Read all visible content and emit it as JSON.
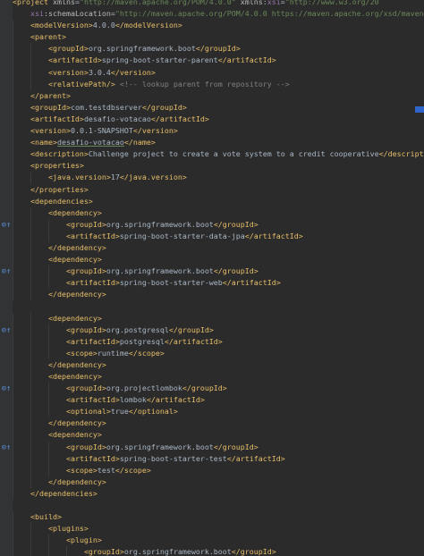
{
  "gutter": {
    "marks": [
      {
        "line": 19,
        "glyph": "⊙↑"
      },
      {
        "line": 23,
        "glyph": "⊙↑"
      },
      {
        "line": 28,
        "glyph": "⊙↑"
      },
      {
        "line": 33,
        "glyph": "⊙↑"
      },
      {
        "line": 38,
        "glyph": "⊙↑"
      }
    ]
  },
  "lines": [
    [
      [
        "t",
        "<project "
      ],
      [
        "a",
        "xmlns"
      ],
      [
        "txt",
        "="
      ],
      [
        "v",
        "\"http://maven.apache.org/POM/4.0.0\" "
      ],
      [
        "a",
        "xmlns"
      ],
      [
        "txt",
        ":"
      ],
      [
        "ns",
        "xsi"
      ],
      [
        "txt",
        "="
      ],
      [
        "v",
        "\"http://www.w3.org/20"
      ]
    ],
    [
      [
        "ns",
        "    xsi"
      ],
      [
        "txt",
        ":"
      ],
      [
        "a",
        "schemaLocation"
      ],
      [
        "txt",
        "="
      ],
      [
        "v",
        "\"http://maven.apache.org/POM/4.0.0 https://maven.apache.org/xsd/maven"
      ]
    ],
    [
      [
        "txt",
        "    "
      ],
      [
        "t",
        "<modelVersion>"
      ],
      [
        "txt",
        "4.0.0"
      ],
      [
        "t",
        "</modelVersion>"
      ]
    ],
    [
      [
        "txt",
        "    "
      ],
      [
        "t",
        "<parent>"
      ]
    ],
    [
      [
        "txt",
        "        "
      ],
      [
        "t",
        "<groupId>"
      ],
      [
        "txt",
        "org.springframework.boot"
      ],
      [
        "t",
        "</groupId>"
      ]
    ],
    [
      [
        "txt",
        "        "
      ],
      [
        "t",
        "<artifactId>"
      ],
      [
        "txt",
        "spring-boot-starter-parent"
      ],
      [
        "t",
        "</artifactId>"
      ]
    ],
    [
      [
        "txt",
        "        "
      ],
      [
        "t",
        "<version>"
      ],
      [
        "txt",
        "3.0.4"
      ],
      [
        "t",
        "</version>"
      ]
    ],
    [
      [
        "txt",
        "        "
      ],
      [
        "t",
        "<relativePath/>"
      ],
      [
        "c",
        " <!-- lookup parent from repository -->"
      ]
    ],
    [
      [
        "txt",
        "    "
      ],
      [
        "t",
        "</parent>"
      ]
    ],
    [
      [
        "txt",
        "    "
      ],
      [
        "t",
        "<groupId>"
      ],
      [
        "txt",
        "com.testdbserver"
      ],
      [
        "t",
        "</groupId>"
      ]
    ],
    [
      [
        "txt",
        "    "
      ],
      [
        "t",
        "<artifactId>"
      ],
      [
        "txt",
        "desafio-votacao"
      ],
      [
        "t",
        "</artifactId>"
      ]
    ],
    [
      [
        "txt",
        "    "
      ],
      [
        "t",
        "<version>"
      ],
      [
        "txt",
        "0.0.1-SNAPSHOT"
      ],
      [
        "t",
        "</version>"
      ]
    ],
    [
      [
        "txt",
        "    "
      ],
      [
        "t",
        "<name>"
      ],
      [
        "u",
        "desafio-votacao"
      ],
      [
        "t",
        "</name>"
      ]
    ],
    [
      [
        "txt",
        "    "
      ],
      [
        "t",
        "<description>"
      ],
      [
        "txt",
        "Challenge project to create a vote system to a credit cooperative"
      ],
      [
        "t",
        "</descript"
      ]
    ],
    [
      [
        "txt",
        "    "
      ],
      [
        "t",
        "<properties>"
      ]
    ],
    [
      [
        "txt",
        "        "
      ],
      [
        "t",
        "<java.version>"
      ],
      [
        "txt",
        "17"
      ],
      [
        "t",
        "</java.version>"
      ]
    ],
    [
      [
        "txt",
        "    "
      ],
      [
        "t",
        "</properties>"
      ]
    ],
    [
      [
        "txt",
        "    "
      ],
      [
        "t",
        "<dependencies>"
      ]
    ],
    [
      [
        "txt",
        "        "
      ],
      [
        "t",
        "<dependency>"
      ]
    ],
    [
      [
        "txt",
        "            "
      ],
      [
        "t",
        "<groupId>"
      ],
      [
        "txt",
        "org.springframework.boot"
      ],
      [
        "t",
        "</groupId>"
      ]
    ],
    [
      [
        "txt",
        "            "
      ],
      [
        "t",
        "<artifactId>"
      ],
      [
        "txt",
        "spring-boot-starter-data-jpa"
      ],
      [
        "t",
        "</artifactId>"
      ]
    ],
    [
      [
        "txt",
        "        "
      ],
      [
        "t",
        "</dependency>"
      ]
    ],
    [
      [
        "txt",
        "        "
      ],
      [
        "t",
        "<dependency>"
      ]
    ],
    [
      [
        "txt",
        "            "
      ],
      [
        "t",
        "<groupId>"
      ],
      [
        "txt",
        "org.springframework.boot"
      ],
      [
        "t",
        "</groupId>"
      ]
    ],
    [
      [
        "txt",
        "            "
      ],
      [
        "t",
        "<artifactId>"
      ],
      [
        "txt",
        "spring-boot-starter-web"
      ],
      [
        "t",
        "</artifactId>"
      ]
    ],
    [
      [
        "txt",
        "        "
      ],
      [
        "t",
        "</dependency>"
      ]
    ],
    [
      [
        "txt",
        ""
      ]
    ],
    [
      [
        "txt",
        "        "
      ],
      [
        "t",
        "<dependency>"
      ]
    ],
    [
      [
        "txt",
        "            "
      ],
      [
        "t",
        "<groupId>"
      ],
      [
        "txt",
        "org.postgresql"
      ],
      [
        "t",
        "</groupId>"
      ]
    ],
    [
      [
        "txt",
        "            "
      ],
      [
        "t",
        "<artifactId>"
      ],
      [
        "txt",
        "postgresql"
      ],
      [
        "t",
        "</artifactId>"
      ]
    ],
    [
      [
        "txt",
        "            "
      ],
      [
        "t",
        "<scope>"
      ],
      [
        "txt",
        "runtime"
      ],
      [
        "t",
        "</scope>"
      ]
    ],
    [
      [
        "txt",
        "        "
      ],
      [
        "t",
        "</dependency>"
      ]
    ],
    [
      [
        "txt",
        "        "
      ],
      [
        "t",
        "<dependency>"
      ]
    ],
    [
      [
        "txt",
        "            "
      ],
      [
        "t",
        "<groupId>"
      ],
      [
        "txt",
        "org.projectlombok"
      ],
      [
        "t",
        "</groupId>"
      ]
    ],
    [
      [
        "txt",
        "            "
      ],
      [
        "t",
        "<artifactId>"
      ],
      [
        "txt",
        "lombok"
      ],
      [
        "t",
        "</artifactId>"
      ]
    ],
    [
      [
        "txt",
        "            "
      ],
      [
        "t",
        "<optional>"
      ],
      [
        "txt",
        "true"
      ],
      [
        "t",
        "</optional>"
      ]
    ],
    [
      [
        "txt",
        "        "
      ],
      [
        "t",
        "</dependency>"
      ]
    ],
    [
      [
        "txt",
        "        "
      ],
      [
        "t",
        "<dependency>"
      ]
    ],
    [
      [
        "txt",
        "            "
      ],
      [
        "t",
        "<groupId>"
      ],
      [
        "txt",
        "org.springframework.boot"
      ],
      [
        "t",
        "</groupId>"
      ]
    ],
    [
      [
        "txt",
        "            "
      ],
      [
        "t",
        "<artifactId>"
      ],
      [
        "txt",
        "spring-boot-starter-test"
      ],
      [
        "t",
        "</artifactId>"
      ]
    ],
    [
      [
        "txt",
        "            "
      ],
      [
        "t",
        "<scope>"
      ],
      [
        "txt",
        "test"
      ],
      [
        "t",
        "</scope>"
      ]
    ],
    [
      [
        "txt",
        "        "
      ],
      [
        "t",
        "</dependency>"
      ]
    ],
    [
      [
        "txt",
        "    "
      ],
      [
        "t",
        "</dependencies>"
      ]
    ],
    [
      [
        "txt",
        ""
      ]
    ],
    [
      [
        "txt",
        "    "
      ],
      [
        "t",
        "<build>"
      ]
    ],
    [
      [
        "txt",
        "        "
      ],
      [
        "t",
        "<plugins>"
      ]
    ],
    [
      [
        "txt",
        "            "
      ],
      [
        "t",
        "<plugin>"
      ]
    ],
    [
      [
        "txt",
        "                "
      ],
      [
        "t",
        "<groupId>"
      ],
      [
        "txt",
        "org.springframework.boot"
      ],
      [
        "t",
        "</groupId>"
      ]
    ]
  ]
}
